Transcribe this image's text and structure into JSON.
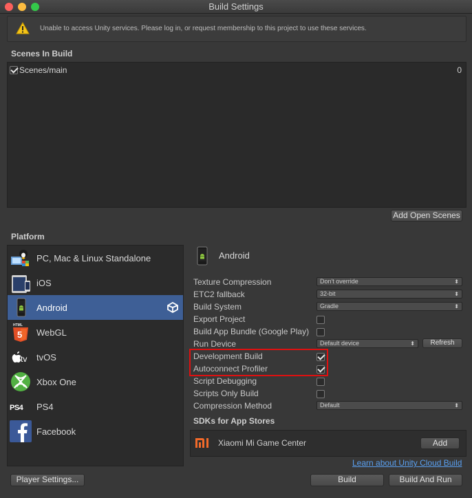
{
  "window": {
    "title": "Build Settings"
  },
  "warning": {
    "text": "Unable to access Unity services. Please log in, or request membership to this project to use these services.",
    "icon": "warning-icon"
  },
  "scenes": {
    "title": "Scenes In Build",
    "items": [
      {
        "label": "Scenes/main",
        "index": "0",
        "checked": true
      }
    ],
    "add_open_scenes_label": "Add Open Scenes"
  },
  "platform": {
    "title": "Platform",
    "items": [
      {
        "label": "PC, Mac & Linux Standalone",
        "icon": "pc-mac-linux-icon"
      },
      {
        "label": "iOS",
        "icon": "ios-icon"
      },
      {
        "label": "Android",
        "icon": "android-icon",
        "selected": true
      },
      {
        "label": "WebGL",
        "icon": "html5-icon"
      },
      {
        "label": "tvOS",
        "icon": "apple-tv-icon"
      },
      {
        "label": "Xbox One",
        "icon": "xbox-icon"
      },
      {
        "label": "PS4",
        "icon": "ps4-icon"
      },
      {
        "label": "Facebook",
        "icon": "facebook-icon"
      }
    ]
  },
  "android": {
    "header": "Android",
    "texture_compression": {
      "label": "Texture Compression",
      "value": "Don't override"
    },
    "etc2_fallback": {
      "label": "ETC2 fallback",
      "value": "32-bit"
    },
    "build_system": {
      "label": "Build System",
      "value": "Gradle"
    },
    "export_project": {
      "label": "Export Project",
      "checked": false
    },
    "build_app_bundle": {
      "label": "Build App Bundle (Google Play)",
      "checked": false
    },
    "run_device": {
      "label": "Run Device",
      "value": "Default device",
      "refresh_label": "Refresh"
    },
    "development_build": {
      "label": "Development Build",
      "checked": true
    },
    "autoconnect_profiler": {
      "label": "Autoconnect Profiler",
      "checked": true
    },
    "script_debugging": {
      "label": "Script Debugging",
      "checked": false
    },
    "scripts_only_build": {
      "label": "Scripts Only Build",
      "checked": false
    },
    "compression_method": {
      "label": "Compression Method",
      "value": "Default"
    }
  },
  "sdks": {
    "title": "SDKs for App Stores",
    "items": [
      {
        "label": "Xiaomi Mi Game Center",
        "icon": "xiaomi-icon",
        "button": "Add"
      }
    ],
    "learn_link": "Learn about Unity Cloud Build"
  },
  "footer": {
    "player_settings_label": "Player Settings...",
    "build_label": "Build",
    "build_and_run_label": "Build And Run"
  },
  "colors": {
    "selection": "#3e5f96",
    "highlight": "#e01010",
    "link": "#5aa0f0"
  }
}
